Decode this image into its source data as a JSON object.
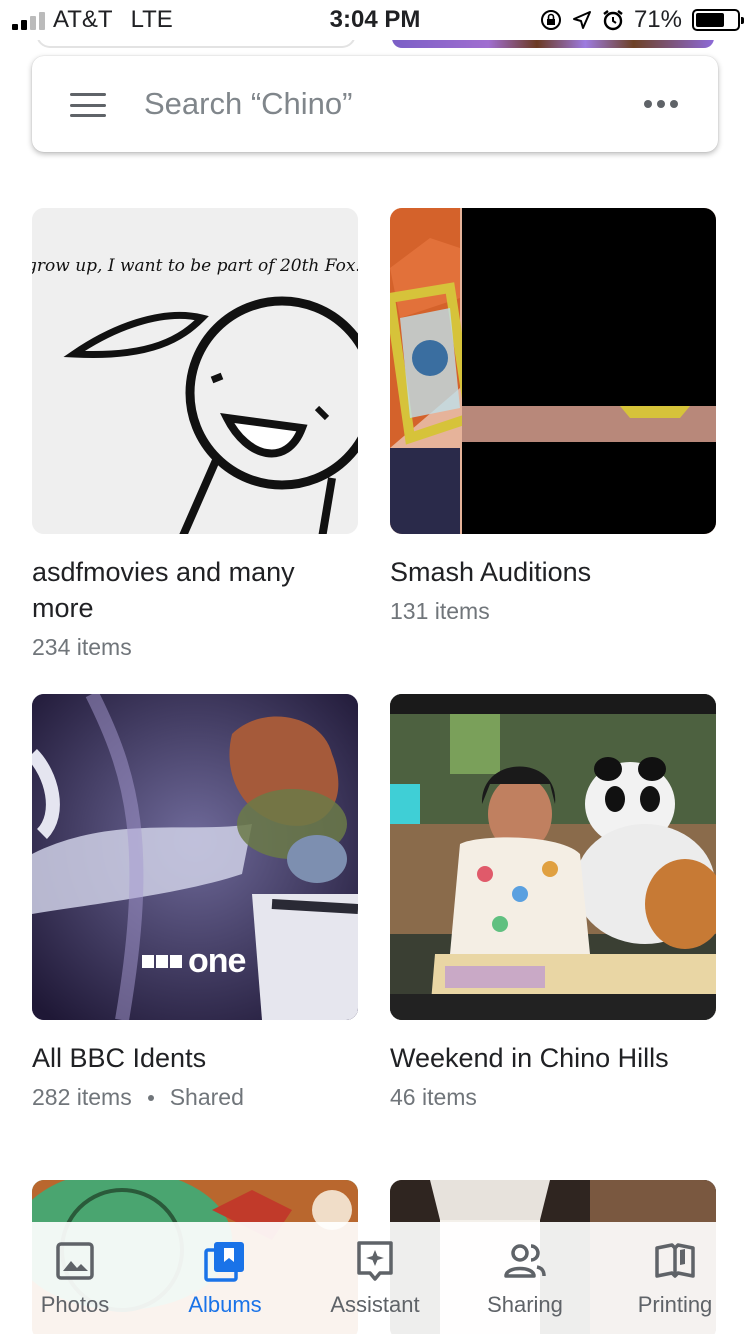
{
  "status_bar": {
    "carrier": "AT&T",
    "network": "LTE",
    "time": "3:04 PM",
    "battery": "71%"
  },
  "search": {
    "placeholder": "Search “Chino”"
  },
  "albums": [
    {
      "title": "asdfmovies and many more",
      "meta": "234 items",
      "thumb_caption": "grow up, I want to be part of 20th Fox!"
    },
    {
      "title": "Smash Auditions",
      "meta": "131 items"
    },
    {
      "title": "All BBC Idents",
      "meta": "282 items",
      "shared": "Shared",
      "thumb_caption": "BBC one"
    },
    {
      "title": "Weekend in Chino Hills",
      "meta": "46 items"
    }
  ],
  "nav": {
    "photos": "Photos",
    "albums": "Albums",
    "assistant": "Assistant",
    "sharing": "Sharing",
    "printing": "Printing",
    "active": "albums",
    "active_color": "#1a73e8"
  }
}
